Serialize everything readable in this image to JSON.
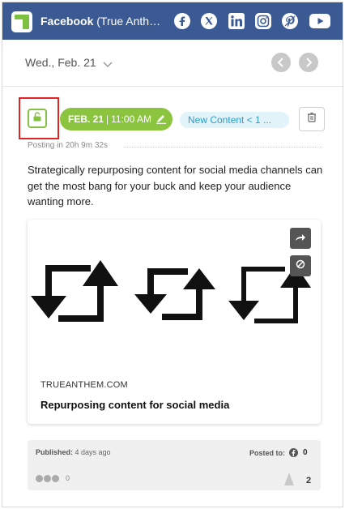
{
  "header": {
    "title_bold": "Facebook",
    "title_rest": " (True Anthem",
    "social_icons": [
      "facebook-icon",
      "x-icon",
      "linkedin-icon",
      "instagram-icon",
      "pinterest-icon",
      "youtube-icon"
    ],
    "colors": {
      "bar": "#3b5a94",
      "logo": "#7ec140"
    }
  },
  "date_nav": {
    "date_label": "Wed., Feb. 21"
  },
  "post": {
    "schedule_date": "FEB. 21",
    "schedule_sep": "|",
    "schedule_time": "11:00 AM",
    "tag_label": "New Content < 1 ...",
    "posting_in": "Posting in 20h 9m 32s",
    "body": "Strategically repurposing content for social media channels can get the most bang for your buck and keep your audience wanting more.",
    "colors": {
      "accent_green": "#8bc53f",
      "tag_blue": "#2a9bc6",
      "highlight_red": "#e22323"
    }
  },
  "link_card": {
    "domain": "TRUEANTHEM.COM",
    "title": "Repurposing content for social media"
  },
  "stats": {
    "published_label": "Published:",
    "published_value": "4 days ago",
    "posted_to_label": "Posted to:",
    "posted_to_count": "0",
    "reactions_count": "0",
    "spike_count": "2"
  }
}
